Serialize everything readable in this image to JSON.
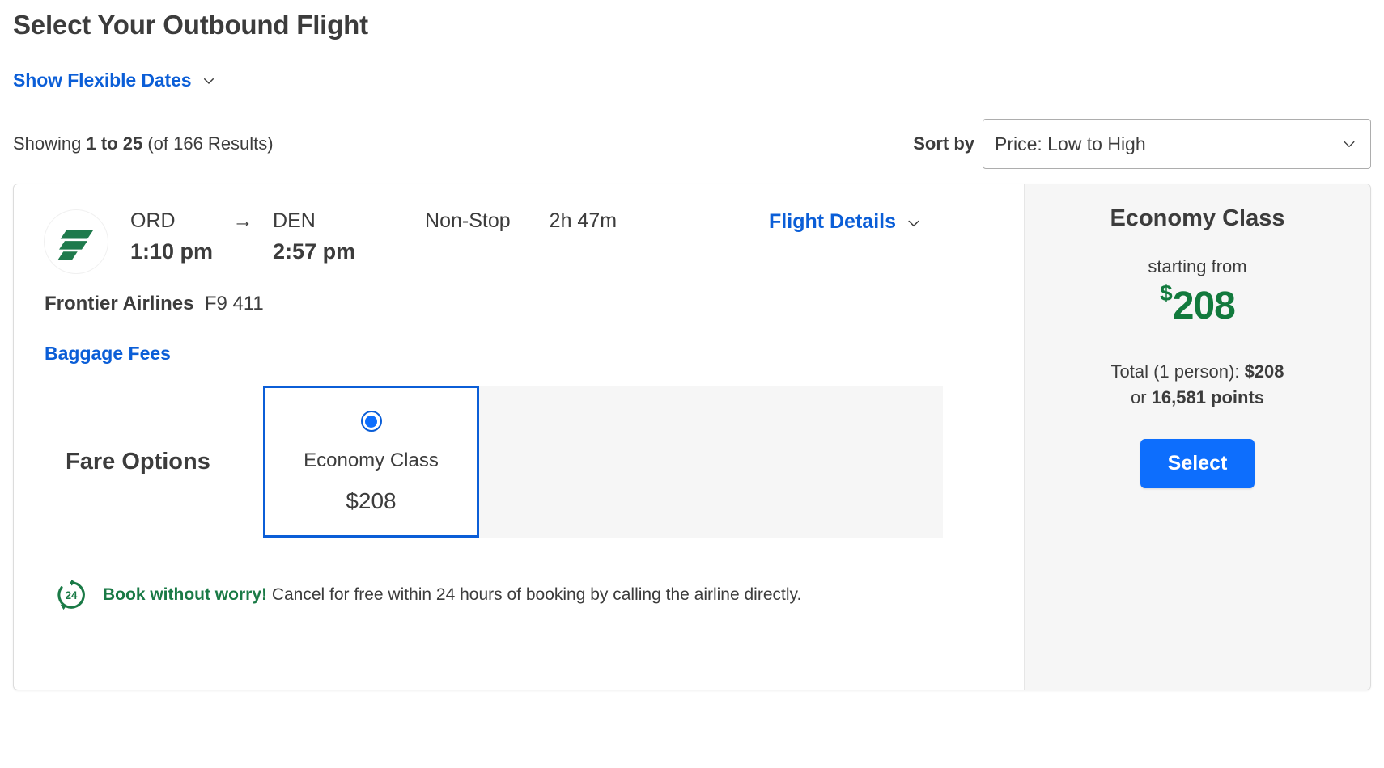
{
  "header": {
    "title": "Select Your Outbound Flight",
    "flexible_dates_link": "Show Flexible Dates",
    "flexible_dates_icon": "chevron-down-icon"
  },
  "results_bar": {
    "showing_prefix": "Showing ",
    "showing_range": "1 to 25",
    "showing_suffix": " (of 166 Results)",
    "sort_label": "Sort by",
    "sort_value": "Price: Low to High",
    "sort_caret_icon": "chevron-down-icon"
  },
  "flight": {
    "airline_logo_icon": "frontier-airlines-logo",
    "origin_code": "ORD",
    "origin_time": "1:10 pm",
    "arrow": "→",
    "destination_code": "DEN",
    "destination_time": "2:57 pm",
    "stops": "Non-Stop",
    "duration": "2h 47m",
    "details_link": "Flight Details",
    "details_icon": "chevron-down-icon",
    "airline_name": "Frontier Airlines",
    "flight_number": "F9 411",
    "baggage_link": "Baggage Fees",
    "fare_options_label": "Fare Options",
    "fare_option": {
      "name": "Economy Class",
      "price": "$208",
      "selected": true,
      "radio_icon": "radio-selected-icon"
    },
    "worry": {
      "icon": "24-hour-refresh-icon",
      "headline": "Book without worry!",
      "body": " Cancel for free within 24 hours of booking by calling the airline directly."
    }
  },
  "price_panel": {
    "class_name": "Economy Class",
    "starting_from": "starting from",
    "currency_symbol": "$",
    "price_amount": "208",
    "total_prefix": "Total (1 person): ",
    "total_amount": "$208",
    "points_prefix": "or ",
    "points_amount": "16,581 points",
    "select_button": "Select"
  },
  "colors": {
    "link_blue": "#0b5ed7",
    "button_blue": "#0d6efd",
    "price_green": "#127a3d",
    "frontier_green": "#1e7a4c",
    "panel_gray": "#f6f6f6",
    "text_dark": "#3c3c3c"
  }
}
